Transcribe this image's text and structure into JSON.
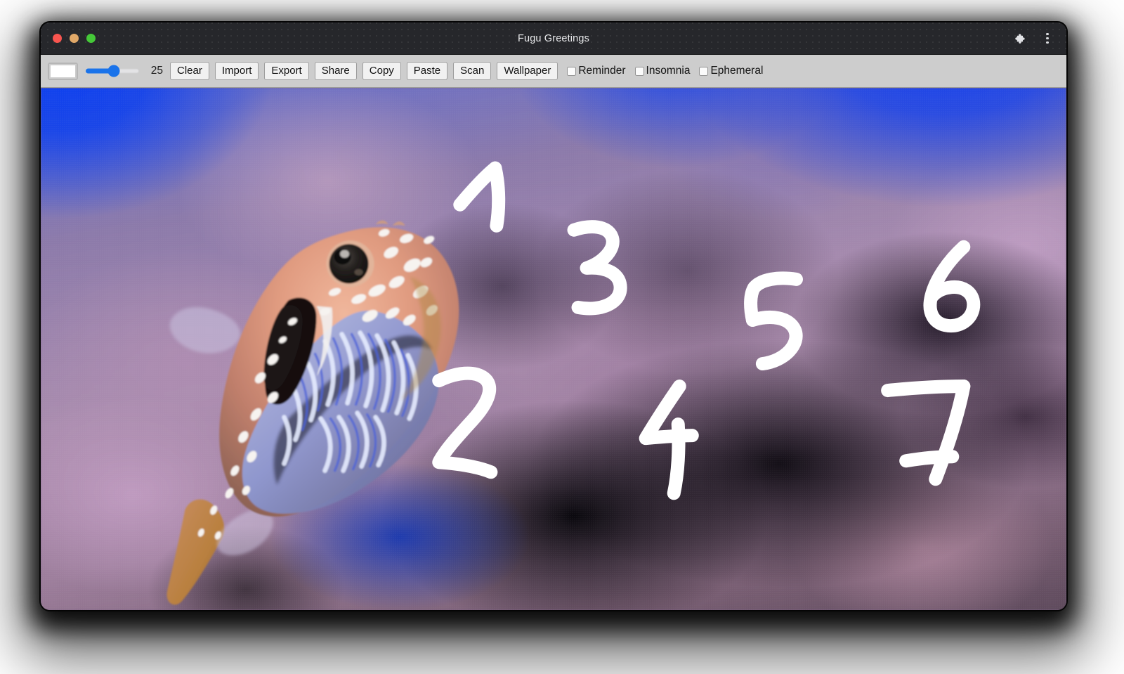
{
  "window": {
    "title": "Fugu Greetings",
    "traffic_lights": [
      "close",
      "minimize",
      "maximize"
    ],
    "extensions_icon": "puzzle-piece-icon",
    "menu_icon": "kebab-menu-icon",
    "colors": {
      "titlebar": "#26272b",
      "toolbar": "#cdcdcd",
      "accent": "#1a73ea",
      "close": "#f9554f",
      "minimize": "#e0a868",
      "maximize": "#45c838"
    }
  },
  "toolbar": {
    "color_picker": {
      "name": "color-picker",
      "value": "#ffffff"
    },
    "stroke_slider": {
      "name": "stroke-width-slider",
      "value": 25,
      "min": 1,
      "max": 50,
      "percent": 52
    },
    "stroke_value_label": "25",
    "buttons": [
      {
        "label": "Clear",
        "name": "clear-button"
      },
      {
        "label": "Import",
        "name": "import-button"
      },
      {
        "label": "Export",
        "name": "export-button"
      },
      {
        "label": "Share",
        "name": "share-button"
      },
      {
        "label": "Copy",
        "name": "copy-button"
      },
      {
        "label": "Paste",
        "name": "paste-button"
      },
      {
        "label": "Scan",
        "name": "scan-button"
      },
      {
        "label": "Wallpaper",
        "name": "wallpaper-button"
      }
    ],
    "checkboxes": [
      {
        "label": "Reminder",
        "name": "reminder-checkbox",
        "checked": false
      },
      {
        "label": "Insomnia",
        "name": "insomnia-checkbox",
        "checked": false
      },
      {
        "label": "Ephemeral",
        "name": "ephemeral-checkbox",
        "checked": false
      }
    ]
  },
  "canvas": {
    "name": "drawing-canvas",
    "background_photo": "blurred underwater coral reef with a papuan toby pufferfish",
    "ink_color": "#ffffff",
    "strokes": [
      "1",
      "2",
      "3",
      "4",
      "5",
      "6",
      "7"
    ]
  }
}
